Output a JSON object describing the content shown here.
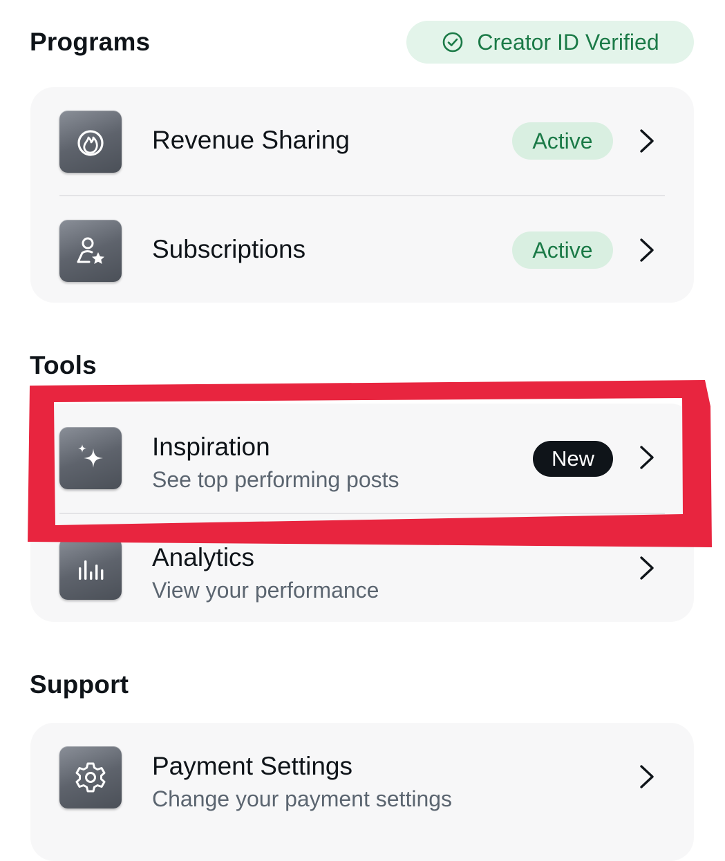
{
  "programs": {
    "heading": "Programs",
    "verified_badge": "Creator ID Verified",
    "items": [
      {
        "icon": "flame-icon",
        "title": "Revenue Sharing",
        "badge": "Active"
      },
      {
        "icon": "person-star-icon",
        "title": "Subscriptions",
        "badge": "Active"
      }
    ]
  },
  "tools": {
    "heading": "Tools",
    "items": [
      {
        "icon": "sparkle-icon",
        "title": "Inspiration",
        "subtitle": "See top performing posts",
        "badge": "New"
      },
      {
        "icon": "bar-chart-icon",
        "title": "Analytics",
        "subtitle": "View your performance"
      }
    ]
  },
  "support": {
    "heading": "Support",
    "items": [
      {
        "icon": "gear-icon",
        "title": "Payment Settings",
        "subtitle": "Change your payment settings"
      }
    ]
  },
  "colors": {
    "verified_green": "#1b7a47",
    "active_badge_bg": "#d9efe1",
    "highlight_red": "#e8253f",
    "card_bg": "#f7f7f8"
  }
}
